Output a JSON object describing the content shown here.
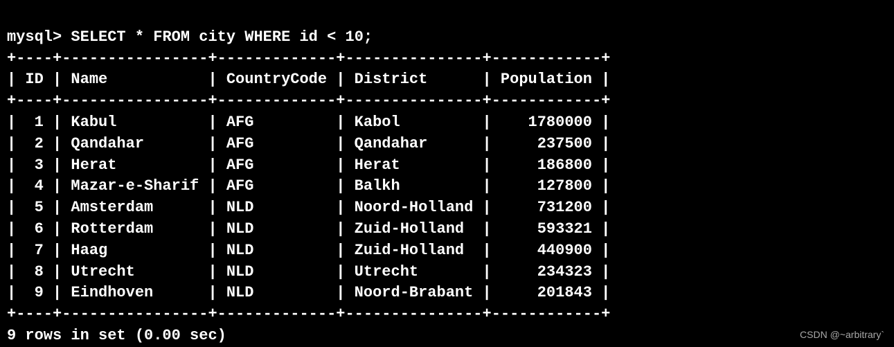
{
  "prompt": "mysql> ",
  "query": "SELECT * FROM city WHERE id < 10;",
  "borderTop": "+----+----------------+-------------+---------------+------------+",
  "headerLine": "| ID | Name           | CountryCode | District      | Population |",
  "borderMid": "+----+----------------+-------------+---------------+------------+",
  "borderBottom": "+----+----------------+-------------+---------------+------------+",
  "columns": [
    "ID",
    "Name",
    "CountryCode",
    "District",
    "Population"
  ],
  "rows": [
    {
      "id": 1,
      "name": "Kabul",
      "countryCode": "AFG",
      "district": "Kabol",
      "population": 1780000
    },
    {
      "id": 2,
      "name": "Qandahar",
      "countryCode": "AFG",
      "district": "Qandahar",
      "population": 237500
    },
    {
      "id": 3,
      "name": "Herat",
      "countryCode": "AFG",
      "district": "Herat",
      "population": 186800
    },
    {
      "id": 4,
      "name": "Mazar-e-Sharif",
      "countryCode": "AFG",
      "district": "Balkh",
      "population": 127800
    },
    {
      "id": 5,
      "name": "Amsterdam",
      "countryCode": "NLD",
      "district": "Noord-Holland",
      "population": 731200
    },
    {
      "id": 6,
      "name": "Rotterdam",
      "countryCode": "NLD",
      "district": "Zuid-Holland",
      "population": 593321
    },
    {
      "id": 7,
      "name": "Haag",
      "countryCode": "NLD",
      "district": "Zuid-Holland",
      "population": 440900
    },
    {
      "id": 8,
      "name": "Utrecht",
      "countryCode": "NLD",
      "district": "Utrecht",
      "population": 234323
    },
    {
      "id": 9,
      "name": "Eindhoven",
      "countryCode": "NLD",
      "district": "Noord-Brabant",
      "population": 201843
    }
  ],
  "rowLines": [
    "|  1 | Kabul          | AFG         | Kabol         |    1780000 |",
    "|  2 | Qandahar       | AFG         | Qandahar      |     237500 |",
    "|  3 | Herat          | AFG         | Herat         |     186800 |",
    "|  4 | Mazar-e-Sharif | AFG         | Balkh         |     127800 |",
    "|  5 | Amsterdam      | NLD         | Noord-Holland |     731200 |",
    "|  6 | Rotterdam      | NLD         | Zuid-Holland  |     593321 |",
    "|  7 | Haag           | NLD         | Zuid-Holland  |     440900 |",
    "|  8 | Utrecht        | NLD         | Utrecht       |     234323 |",
    "|  9 | Eindhoven      | NLD         | Noord-Brabant |     201843 |"
  ],
  "summary": "9 rows in set (0.00 sec)",
  "watermark": "CSDN @~arbitrary`"
}
